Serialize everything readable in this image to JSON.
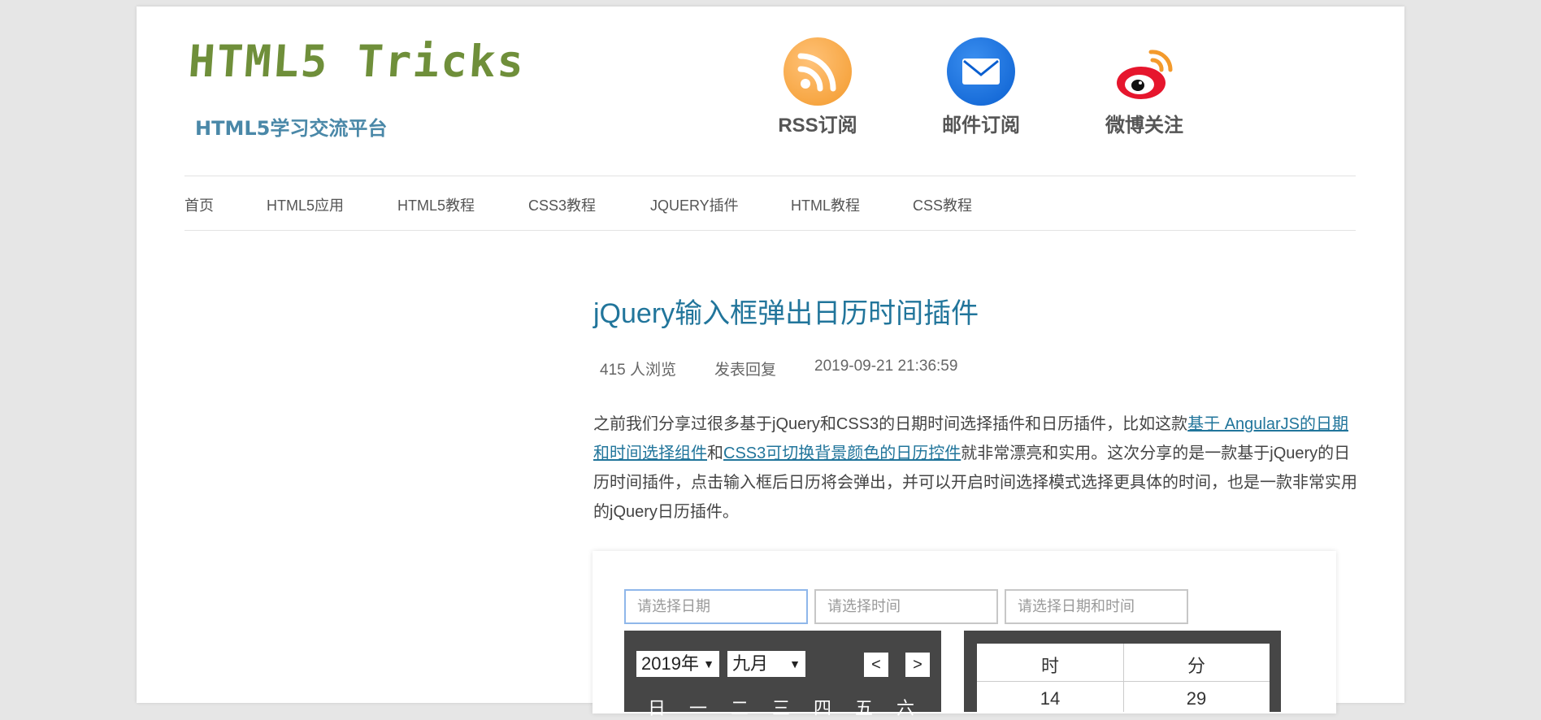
{
  "header": {
    "logo_title": "HTML5 Tricks",
    "logo_subtitle": "HTML5学习交流平台",
    "social": [
      {
        "label": "RSS订阅",
        "icon": "rss-icon"
      },
      {
        "label": "邮件订阅",
        "icon": "mail-icon"
      },
      {
        "label": "微博关注",
        "icon": "weibo-icon"
      }
    ]
  },
  "nav": {
    "items": [
      "首页",
      "HTML5应用",
      "HTML5教程",
      "CSS3教程",
      "JQUERY插件",
      "HTML教程",
      "CSS教程"
    ]
  },
  "article": {
    "title": "jQuery输入框弹出日历时间插件",
    "views": "415 人浏览",
    "reply": "发表回复",
    "date": "2019-09-21 21:36:59",
    "intro_1": "之前我们分享过很多基于jQuery和CSS3的日期时间选择插件和日历插件，比如这款",
    "link_1": "基于 AngularJS的日期和时间选择组件",
    "intro_and": "和",
    "link_2": "CSS3可切换背景颜色的日历控件",
    "intro_2": "就非常漂亮和实用。这次分享的是一款基于jQuery的日历时间插件，点击输入框后日历将会弹出，并可以开启时间选择模式选择更具体的时间，也是一款非常实用的jQuery日历插件。"
  },
  "demo": {
    "date_placeholder": "请选择日期",
    "time_placeholder": "请选择时间",
    "datetime_placeholder": "请选择日期和时间",
    "calendar": {
      "year": "2019年",
      "month": "九月",
      "prev": "<",
      "next": ">",
      "weekdays": [
        "日",
        "一",
        "二",
        "三",
        "四",
        "五",
        "六"
      ]
    },
    "time": {
      "hour_label": "时",
      "minute_label": "分",
      "hour": "14",
      "minute": "29"
    }
  },
  "colors": {
    "logo_green": "#6f8f3a",
    "link_blue": "#21759b",
    "calendar_bg": "#464646"
  }
}
